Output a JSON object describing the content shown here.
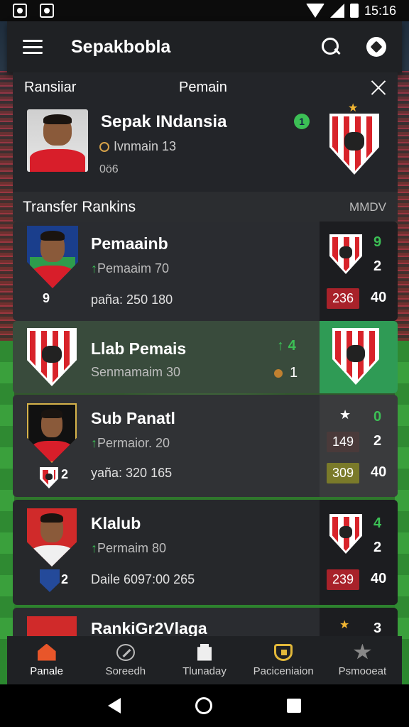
{
  "status_bar": {
    "time": "15:16"
  },
  "app_bar": {
    "title": "Sepakbobla"
  },
  "header": {
    "left_label": "Ransiiar",
    "center_label": "Pemain",
    "player_name": "Sepak INdansia",
    "player_sub": "Ivnmain 13",
    "player_code": "0ö6",
    "badge_text": "1"
  },
  "rankings": {
    "title": "Transfer Rankins",
    "right_label": "MMDV",
    "cards": [
      {
        "name": "Pemaainb",
        "sub": "Pemaaim 70",
        "stat": "paña: 250 180",
        "small": "9",
        "side_top": "9",
        "side_mid": "2",
        "pill": "236",
        "pill_right": "40"
      },
      {
        "name": "Llab Pemais",
        "sub": "Senmamaim 30",
        "rank": "4",
        "num": "1"
      },
      {
        "name": "Sub Panatl",
        "sub": "Permaior. 20",
        "stat": "yaña: 320 165",
        "badge_num": "2",
        "side_top": "0",
        "pill_mid": "149",
        "side_mid": "2",
        "pill_low": "309",
        "pill_low_right": "40"
      },
      {
        "name": "Klalub",
        "sub": "Permaim 80",
        "stat": "Daile 6097:00 265",
        "badge_num": "2",
        "side_top": "4",
        "side_mid": "2",
        "pill": "239",
        "pill_right": "40"
      },
      {
        "name": "RankiGr2Vlaga",
        "side_top": "3"
      }
    ]
  },
  "bottom_nav": {
    "items": [
      {
        "label": "Panale",
        "icon": "home-icon"
      },
      {
        "label": "Soreedh",
        "icon": "compass-icon"
      },
      {
        "label": "Tlunaday",
        "icon": "trophy-icon"
      },
      {
        "label": "Paciceniaion",
        "icon": "badge-icon"
      },
      {
        "label": "Psmooeat",
        "icon": "star-icon"
      }
    ]
  },
  "colors": {
    "accent_green": "#3cbf55",
    "nav_active": "#e8562a",
    "card_green": "#2f9b55",
    "pill_red": "#a8222a"
  }
}
